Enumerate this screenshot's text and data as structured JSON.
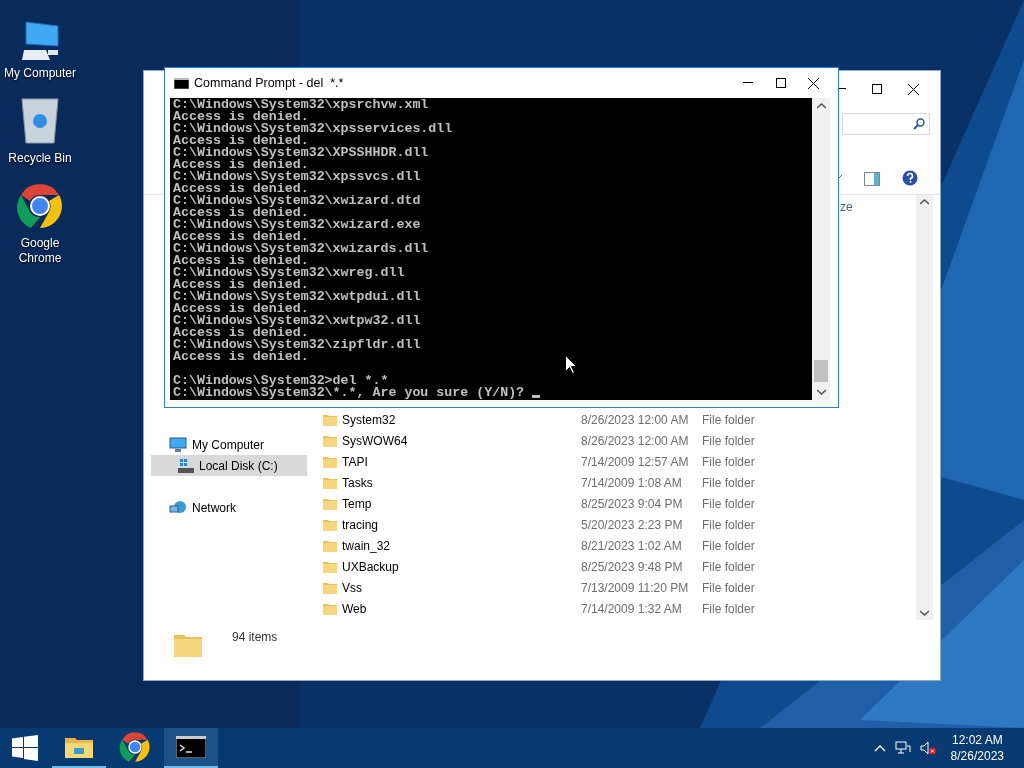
{
  "desktop_icons": [
    {
      "label": "My Computer",
      "kind": "computer"
    },
    {
      "label": "Recycle Bin",
      "kind": "recycle"
    },
    {
      "label": "Google Chrome",
      "kind": "chrome"
    }
  ],
  "explorer": {
    "column_header": "ze",
    "nav_items": [
      {
        "label": "My Computer",
        "kind": "computer",
        "selected": false
      },
      {
        "label": "Local Disk (C:)",
        "kind": "disk",
        "selected": true
      },
      {
        "label": "Network",
        "kind": "network",
        "selected": false
      }
    ],
    "files": [
      {
        "name": "System32",
        "date": "8/26/2023 12:00 AM",
        "type": "File folder"
      },
      {
        "name": "SysWOW64",
        "date": "8/26/2023 12:00 AM",
        "type": "File folder"
      },
      {
        "name": "TAPI",
        "date": "7/14/2009 12:57 AM",
        "type": "File folder"
      },
      {
        "name": "Tasks",
        "date": "7/14/2009 1:08 AM",
        "type": "File folder"
      },
      {
        "name": "Temp",
        "date": "8/25/2023 9:04 PM",
        "type": "File folder"
      },
      {
        "name": "tracing",
        "date": "5/20/2023 2:23 PM",
        "type": "File folder"
      },
      {
        "name": "twain_32",
        "date": "8/21/2023 1:02 AM",
        "type": "File folder"
      },
      {
        "name": "UXBackup",
        "date": "8/25/2023 9:48 PM",
        "type": "File folder"
      },
      {
        "name": "Vss",
        "date": "7/13/2009 11:20 PM",
        "type": "File folder"
      },
      {
        "name": "Web",
        "date": "7/14/2009 1:32 AM",
        "type": "File folder"
      }
    ],
    "status": "94 items"
  },
  "cmd": {
    "title": "Command Prompt - del  *.*",
    "output": [
      "C:\\Windows\\System32\\xpsrchvw.xml",
      "Access is denied.",
      "C:\\Windows\\System32\\xpsservices.dll",
      "Access is denied.",
      "C:\\Windows\\System32\\XPSSHHDR.dll",
      "Access is denied.",
      "C:\\Windows\\System32\\xpssvcs.dll",
      "Access is denied.",
      "C:\\Windows\\System32\\xwizard.dtd",
      "Access is denied.",
      "C:\\Windows\\System32\\xwizard.exe",
      "Access is denied.",
      "C:\\Windows\\System32\\xwizards.dll",
      "Access is denied.",
      "C:\\Windows\\System32\\xwreg.dll",
      "Access is denied.",
      "C:\\Windows\\System32\\xwtpdui.dll",
      "Access is denied.",
      "C:\\Windows\\System32\\xwtpw32.dll",
      "Access is denied.",
      "C:\\Windows\\System32\\zipfldr.dll",
      "Access is denied."
    ],
    "prompt_lines": [
      "C:\\Windows\\System32>del *.*",
      "C:\\Windows\\System32\\*.*, Are you sure (Y/N)?"
    ]
  },
  "taskbar": {
    "apps": [
      {
        "kind": "explorer",
        "running": true,
        "selected": false
      },
      {
        "kind": "chrome",
        "running": false,
        "selected": false
      },
      {
        "kind": "cmd",
        "running": true,
        "selected": true
      }
    ],
    "time": "12:02 AM",
    "date": "8/26/2023"
  }
}
